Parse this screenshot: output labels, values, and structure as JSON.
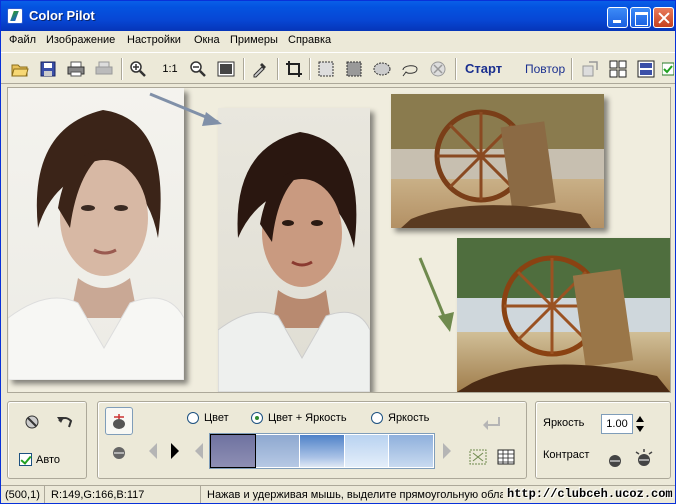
{
  "window": {
    "title": "Color Pilot"
  },
  "menu": [
    "Файл",
    "Изображение",
    "Настройки",
    "Окна",
    "Примеры",
    "Справка"
  ],
  "toolbar": {
    "zoom_label": "1:1",
    "start_label": "Старт",
    "repeat_label": "Повтор"
  },
  "mode": {
    "options": [
      "Цвет",
      "Цвет + Яркость",
      "Яркость"
    ],
    "selected": "Цвет + Яркость"
  },
  "auto": {
    "label": "Авто",
    "checked": true
  },
  "brightness": {
    "label": "Яркость",
    "value": "1.00"
  },
  "contrast": {
    "label": "Контраст"
  },
  "status": {
    "coords": "(500,1)",
    "rgb": "R:149,G:166,B:117",
    "hint": "Нажав и удерживая мышь, выделите прямоугольную обла"
  },
  "watermark": "http://clubceh.ucoz.com",
  "colors": {
    "titlebar": "#0453E0",
    "accent_text": "#1a2f8f"
  }
}
